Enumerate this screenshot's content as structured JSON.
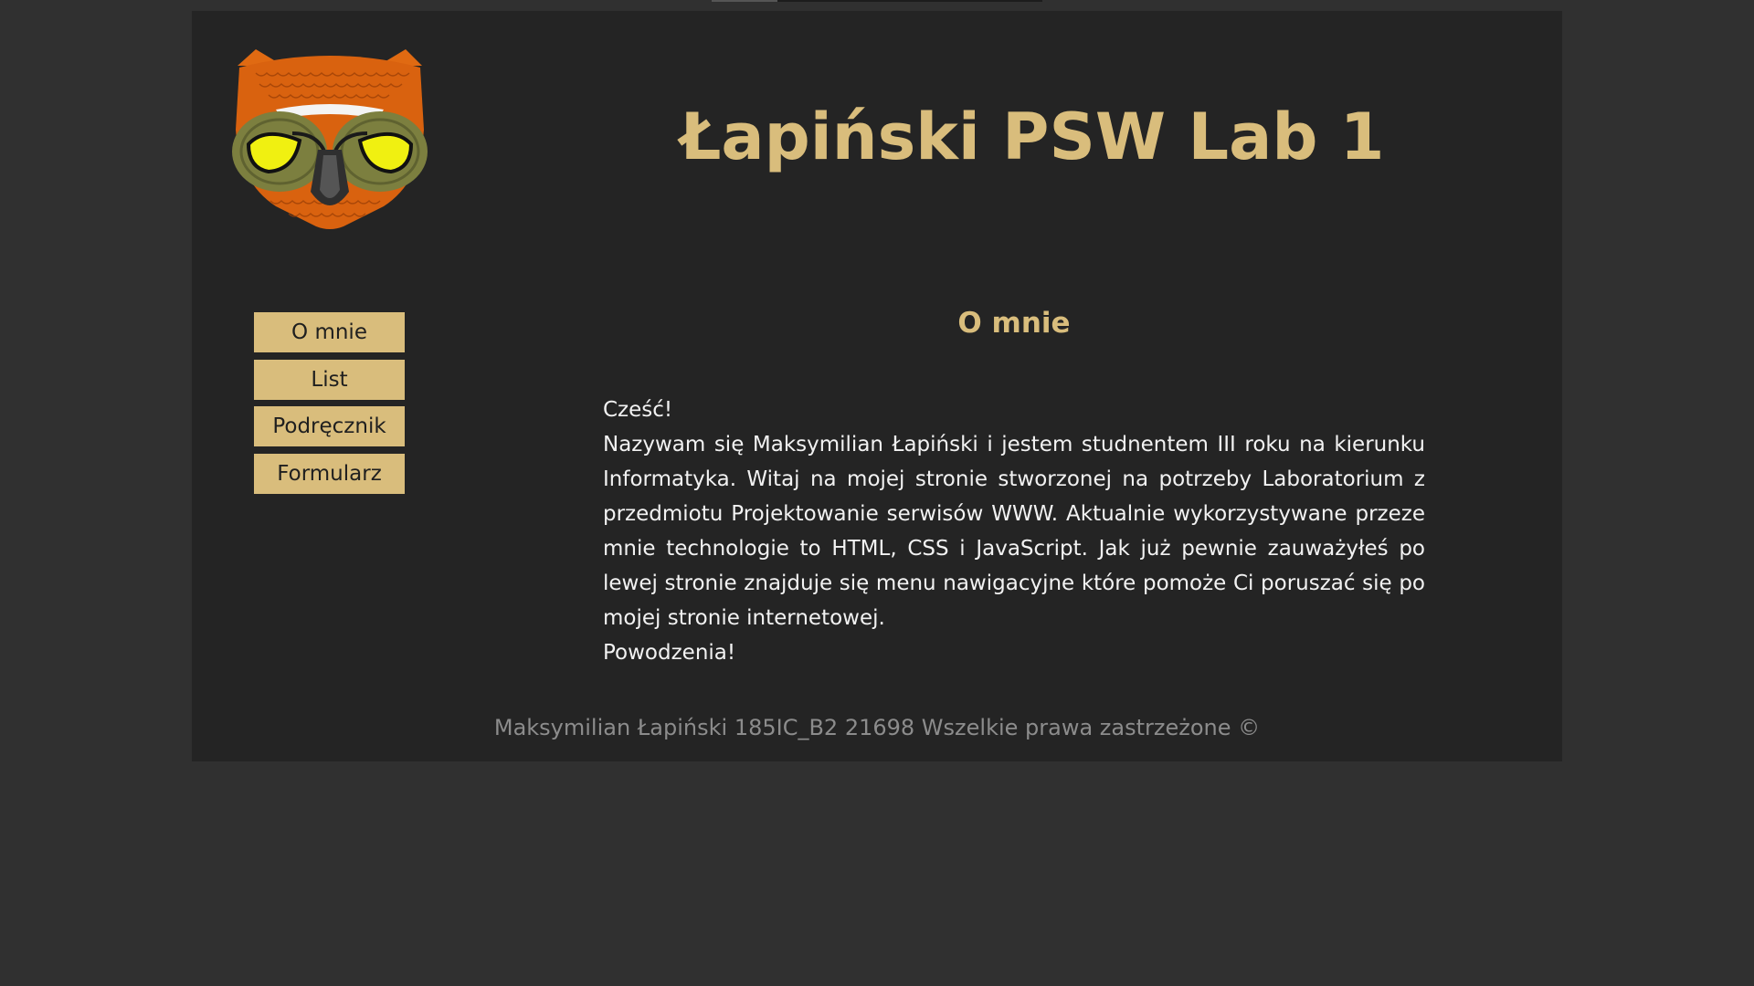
{
  "header": {
    "title": "Łapiński PSW Lab 1",
    "logo": "owl-logo"
  },
  "nav": {
    "items": [
      {
        "label": "O mnie"
      },
      {
        "label": "List"
      },
      {
        "label": "Podręcznik"
      },
      {
        "label": "Formularz"
      }
    ]
  },
  "main": {
    "title": "O mnie",
    "greeting": "Cześć!",
    "body": "Nazywam się Maksymilian Łapiński i jestem studnentem III roku na kierunku Informatyka. Witaj na mojej stronie stworzonej na potrzeby Laboratorium z przedmiotu Projektowanie serwisów WWW. Aktualnie wykorzystywane przeze mnie technologie to HTML, CSS i JavaScript. Jak już pewnie zauważyłeś po lewej stronie znajduje się menu nawigacyjne które pomoże Ci poruszać się po mojej stronie internetowej.",
    "closing": "Powodzenia!"
  },
  "footer": {
    "text": "Maksymilian Łapiński 185IC_B2 21698 Wszelkie prawa zastrzeżone ©"
  },
  "colors": {
    "page_bg": "#303030",
    "panel_bg": "#242424",
    "accent": "#d9bd7c",
    "text": "#f2f2f2",
    "footer_text": "#8c8c8c"
  }
}
